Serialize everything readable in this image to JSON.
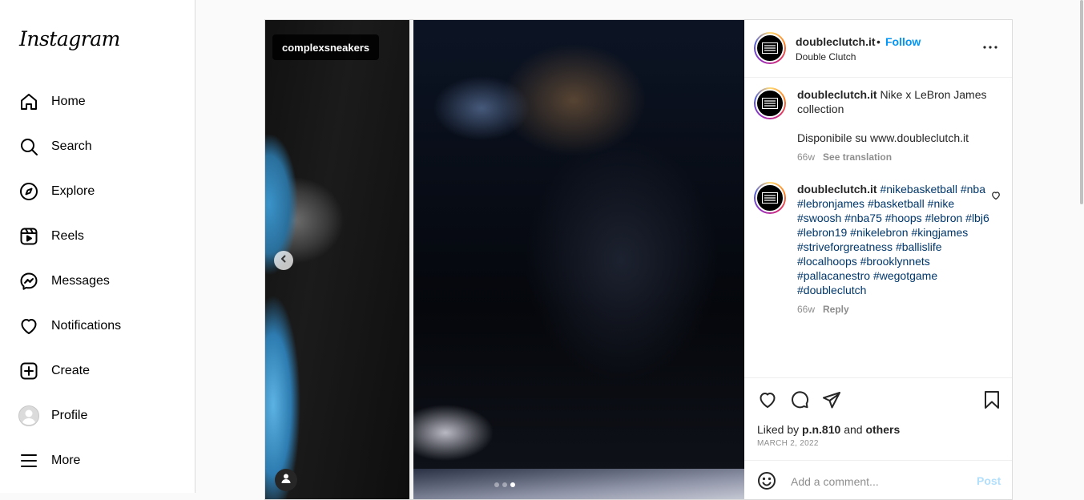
{
  "app": {
    "logo": "Instagram"
  },
  "sidebar": {
    "items": [
      {
        "label": "Home",
        "icon": "home-icon"
      },
      {
        "label": "Search",
        "icon": "search-icon"
      },
      {
        "label": "Explore",
        "icon": "compass-icon"
      },
      {
        "label": "Reels",
        "icon": "reels-icon"
      },
      {
        "label": "Messages",
        "icon": "messenger-icon"
      },
      {
        "label": "Notifications",
        "icon": "heart-icon"
      },
      {
        "label": "Create",
        "icon": "plus-square-icon"
      },
      {
        "label": "Profile",
        "icon": "avatar-icon"
      },
      {
        "label": "More",
        "icon": "menu-icon"
      }
    ]
  },
  "post": {
    "tagged_account": "complexsneakers",
    "carousel": {
      "slides": 3,
      "active_index": 2
    },
    "header": {
      "username": "doubleclutch.it",
      "separator": "•",
      "follow_label": "Follow",
      "subtitle": "Double Clutch",
      "avatar_text": "DOUBLE CLUTCH"
    },
    "caption": {
      "username": "doubleclutch.it",
      "text": "Nike x LeBron James collection",
      "line2": "Disponibile su www.doubleclutch.it",
      "age": "66w",
      "translate_label": "See translation"
    },
    "comment": {
      "username": "doubleclutch.it",
      "hashtags": "#nikebasketball #nba #lebronjames #basketball #nike #swoosh #nba75 #hoops #lebron #lbj6 #lebron19 #nikelebron #kingjames #striveforgreatness #ballislife #localhoops #brooklynnets #pallacanestro #wegotgame #doubleclutch",
      "age": "66w",
      "reply_label": "Reply"
    },
    "likes": {
      "prefix": "Liked by",
      "user": "p.n.810",
      "conj": "and",
      "others": "others"
    },
    "date": "MARCH 2, 2022",
    "add_comment": {
      "placeholder": "Add a comment...",
      "post_label": "Post"
    }
  },
  "colors": {
    "link_blue": "#0095f6",
    "hashtag": "#00376b",
    "muted": "#8e8e8e"
  }
}
